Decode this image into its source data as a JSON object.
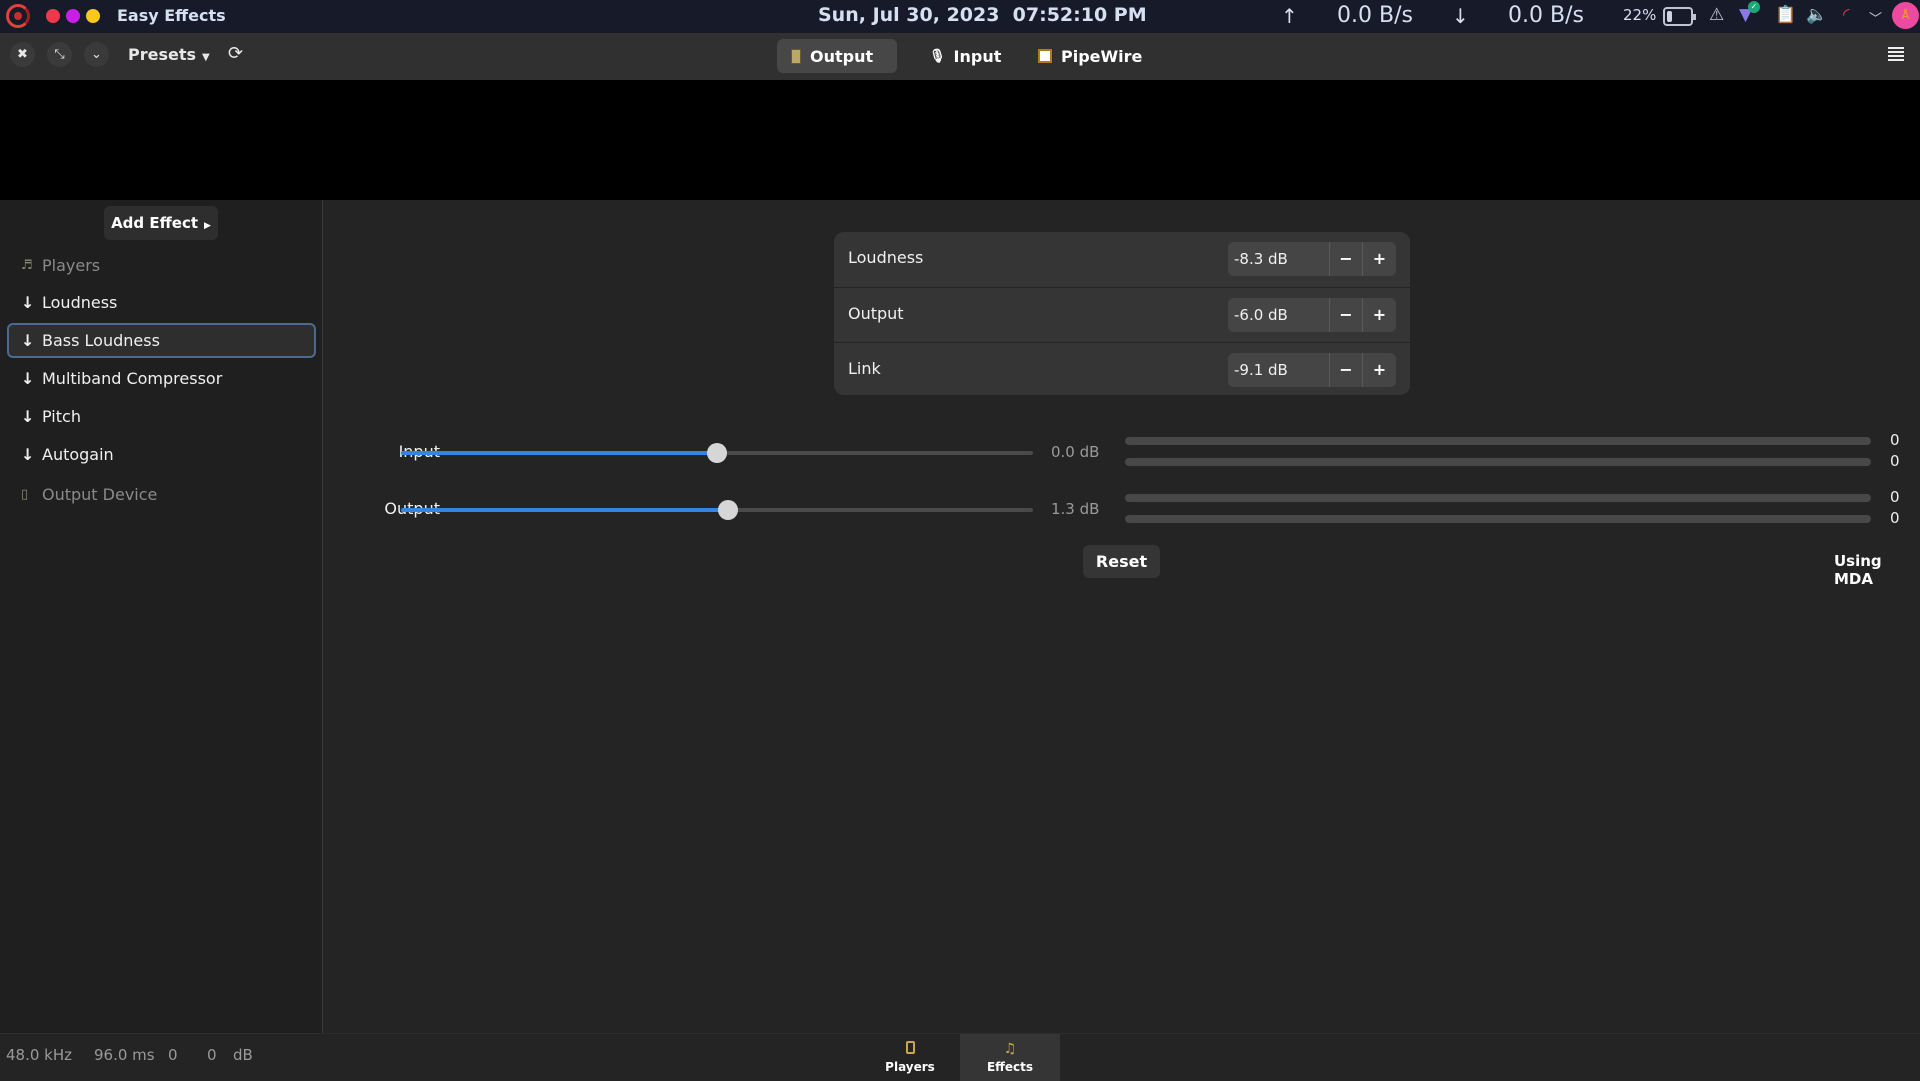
{
  "topbar": {
    "app_title": "Easy Effects",
    "datetime": "Sun, Jul 30, 2023  07:52:10 PM",
    "upload_arrow": "↑",
    "upload_rate": "0.0 B/s",
    "download_arrow": "↓",
    "download_rate": "0.0 B/s",
    "battery_percent": "22%",
    "window_dot_colors": [
      "#f0384c",
      "#c81ee8",
      "#f8c81c"
    ],
    "tray_icons": [
      "notification-icon",
      "vpn-check-icon",
      "clipboard-icon",
      "volume-icon",
      "network-icon",
      "chevron-down-icon"
    ]
  },
  "headerbar": {
    "presets_label": "Presets",
    "view_tabs": [
      {
        "label": "Output",
        "active": true
      },
      {
        "label": "Input",
        "active": false
      },
      {
        "label": "PipeWire",
        "active": false
      }
    ]
  },
  "sidebar": {
    "add_effect_label": "Add Effect",
    "items": [
      {
        "label": "Players",
        "type": "source"
      },
      {
        "label": "Loudness",
        "type": "effect"
      },
      {
        "label": "Bass Loudness",
        "type": "effect",
        "selected": true
      },
      {
        "label": "Multiband Compressor",
        "type": "effect"
      },
      {
        "label": "Pitch",
        "type": "effect"
      },
      {
        "label": "Autogain",
        "type": "effect"
      },
      {
        "label": "Output Device",
        "type": "sink"
      }
    ]
  },
  "plugin": {
    "params": [
      {
        "label": "Loudness",
        "value": "-8.3 dB"
      },
      {
        "label": "Output",
        "value": "-6.0 dB"
      },
      {
        "label": "Link",
        "value": "-9.1 dB"
      }
    ],
    "minus_label": "−",
    "plus_label": "+",
    "gains": [
      {
        "label": "Input",
        "value": "0.0 dB",
        "fraction": 0.5,
        "meters": [
          "0",
          "0"
        ],
        "meter_levels": [
          0,
          0
        ]
      },
      {
        "label": "Output",
        "value": "1.3 dB",
        "fraction": 0.517,
        "meters": [
          "0",
          "0"
        ],
        "meter_levels": [
          0,
          0
        ]
      }
    ],
    "reset_label": "Reset",
    "backend_label": "Using MDA"
  },
  "statusbar": {
    "sample_rate": "48.0 kHz",
    "latency": "96.0 ms",
    "level_left": "0",
    "level_right": "0",
    "level_unit": "dB"
  },
  "bottom_tabs": [
    {
      "label": "Players",
      "active": false
    },
    {
      "label": "Effects",
      "active": true
    }
  ],
  "colors": {
    "accent": "#3584e4",
    "selected_border": "#4a6a92",
    "avatar": "#ec4a9e"
  }
}
